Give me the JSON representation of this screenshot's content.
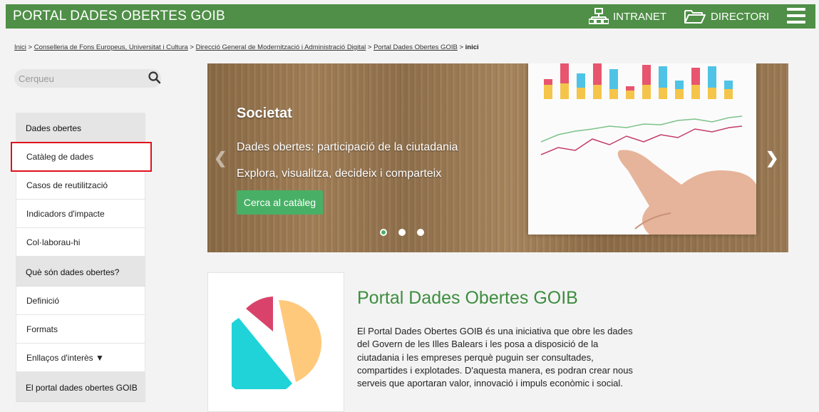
{
  "header": {
    "title": "PORTAL DADES OBERTES GOIB",
    "intranet": "INTRANET",
    "directori": "DIRECTORI",
    "bg_color": "#4f8f47"
  },
  "breadcrumb": {
    "items": [
      "Inici",
      "Conselleria de Fons Europeus, Universitat i Cultura",
      "Direcció General de Modernització i Administració Digital",
      "Portal Dades Obertes GOIB"
    ],
    "current": "inici",
    "separator": ">"
  },
  "search": {
    "placeholder": "Cerqueu"
  },
  "sidebar": {
    "sections": [
      {
        "heading": "Dades obertes",
        "items": [
          "Catàleg de dades",
          "Casos de reutilització",
          "Indicadors d'impacte",
          "Col·laborau-hi"
        ]
      },
      {
        "heading": "Què són dades obertes?",
        "items": [
          "Definició",
          "Formats",
          "Enllaços d'interès ▼"
        ]
      },
      {
        "heading": "El portal dades obertes GOIB",
        "items": []
      }
    ]
  },
  "hero": {
    "heading": "Societat",
    "line1": "Dades obertes: participació de la ciutadania",
    "line2": "Explora, visualitza, decideix i comparteix",
    "button": "Cerca al catàleg",
    "slides": 3,
    "active_slide": 1
  },
  "intro": {
    "title": "Portal Dades Obertes GOIB",
    "description": "El Portal Dades Obertes GOIB és una iniciativa que obre les dades del Govern de les Illes Balears i les posa a disposició de la ciutadania i les empreses perquè puguin ser consultades, compartides i explotades. D'aquesta manera, es podran crear nous serveis que aportaran valor, innovació i impuls econòmic i social."
  },
  "colors": {
    "accent_green": "#48b066",
    "title_green": "#3d8d3f",
    "highlight_red": "#e0121c",
    "pie_yellow": "#ffc97c",
    "pie_cyan": "#1fd3d8",
    "pie_pink": "#d9436b"
  }
}
